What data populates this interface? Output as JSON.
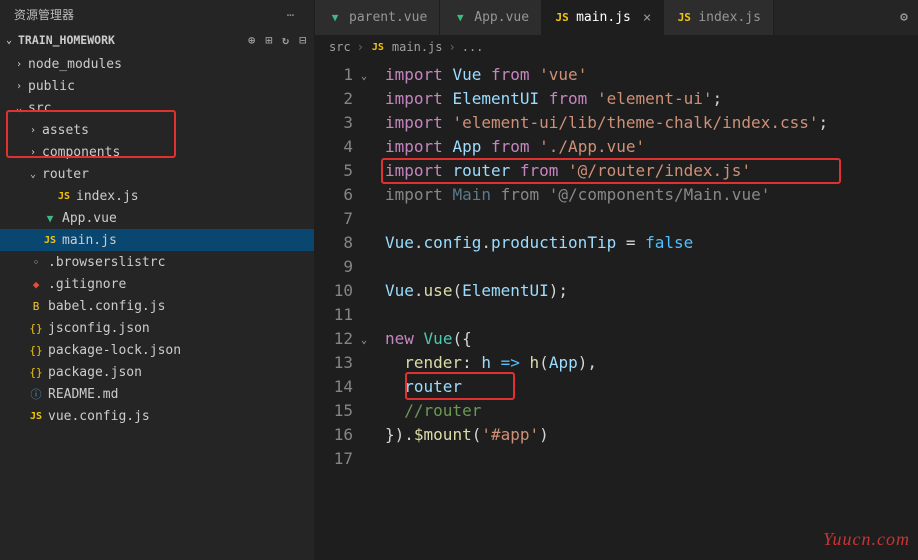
{
  "sidebar": {
    "title": "资源管理器",
    "project": "TRAIN_HOMEWORK",
    "tree": [
      {
        "depth": 0,
        "chev": "›",
        "icon": "",
        "iconCls": "",
        "label": "node_modules"
      },
      {
        "depth": 0,
        "chev": "›",
        "icon": "",
        "iconCls": "",
        "label": "public"
      },
      {
        "depth": 0,
        "chev": "⌄",
        "icon": "",
        "iconCls": "",
        "label": "src"
      },
      {
        "depth": 1,
        "chev": "›",
        "icon": "",
        "iconCls": "",
        "label": "assets"
      },
      {
        "depth": 1,
        "chev": "›",
        "icon": "",
        "iconCls": "",
        "label": "components"
      },
      {
        "depth": 1,
        "chev": "⌄",
        "icon": "",
        "iconCls": "",
        "label": "router",
        "box": "start"
      },
      {
        "depth": 2,
        "chev": "",
        "icon": "JS",
        "iconCls": "ic-js",
        "label": "index.js",
        "box": "end"
      },
      {
        "depth": 1,
        "chev": "",
        "icon": "▼",
        "iconCls": "ic-vue",
        "label": "App.vue"
      },
      {
        "depth": 1,
        "chev": "",
        "icon": "JS",
        "iconCls": "ic-js",
        "label": "main.js",
        "selected": true
      },
      {
        "depth": 0,
        "chev": "",
        "icon": "◦",
        "iconCls": "",
        "label": ".browserslistrc"
      },
      {
        "depth": 0,
        "chev": "",
        "icon": "◆",
        "iconCls": "ic-git",
        "label": ".gitignore"
      },
      {
        "depth": 0,
        "chev": "",
        "icon": "B",
        "iconCls": "ic-babel",
        "label": "babel.config.js"
      },
      {
        "depth": 0,
        "chev": "",
        "icon": "{}",
        "iconCls": "ic-json",
        "label": "jsconfig.json"
      },
      {
        "depth": 0,
        "chev": "",
        "icon": "{}",
        "iconCls": "ic-json",
        "label": "package-lock.json"
      },
      {
        "depth": 0,
        "chev": "",
        "icon": "{}",
        "iconCls": "ic-json",
        "label": "package.json"
      },
      {
        "depth": 0,
        "chev": "",
        "icon": "ⓘ",
        "iconCls": "ic-md",
        "label": "README.md"
      },
      {
        "depth": 0,
        "chev": "",
        "icon": "JS",
        "iconCls": "ic-js",
        "label": "vue.config.js"
      }
    ]
  },
  "tabs": [
    {
      "icon": "▼",
      "iconCls": "ic-vue",
      "label": "parent.vue",
      "active": false
    },
    {
      "icon": "▼",
      "iconCls": "ic-vue",
      "label": "App.vue",
      "active": false
    },
    {
      "icon": "JS",
      "iconCls": "ic-js",
      "label": "main.js",
      "active": true,
      "close": "×"
    },
    {
      "icon": "JS",
      "iconCls": "ic-js",
      "label": "index.js",
      "active": false
    }
  ],
  "breadcrumb": {
    "part1": "src",
    "part2": "main.js",
    "part3": "..."
  },
  "code": {
    "lines": [
      {
        "n": 1,
        "fold": true,
        "html": "<span class='tok-kw'>import</span> <span class='tok-id'>Vue</span> <span class='tok-kw'>from</span> <span class='tok-str'>'vue'</span>"
      },
      {
        "n": 2,
        "html": "<span class='tok-kw'>import</span> <span class='tok-id'>ElementUI</span> <span class='tok-kw'>from</span> <span class='tok-str'>'element-ui'</span><span class='tok-punc'>;</span>"
      },
      {
        "n": 3,
        "html": "<span class='tok-kw'>import</span> <span class='tok-str'>'element-ui/lib/theme-chalk/index.css'</span><span class='tok-punc'>;</span>"
      },
      {
        "n": 4,
        "html": "<span class='tok-kw'>import</span> <span class='tok-id'>App</span> <span class='tok-kw'>from</span> <span class='tok-str'>'./App.vue'</span>"
      },
      {
        "n": 5,
        "html": "<span class='tok-kw'>import</span> <span class='tok-id'>router</span> <span class='tok-kw'>from</span> <span class='tok-str'>'@/router/index.js'</span>"
      },
      {
        "n": 6,
        "html": "<span class='tok-dim'>import</span> <span class='tok-id-dim'>Main</span> <span class='tok-dim'>from</span> <span class='tok-dim'>'@/components/Main.vue'</span>"
      },
      {
        "n": 7,
        "html": ""
      },
      {
        "n": 8,
        "html": "<span class='tok-id'>Vue</span><span class='tok-punc'>.</span><span class='tok-id'>config</span><span class='tok-punc'>.</span><span class='tok-id'>productionTip</span> <span class='tok-op'>=</span> <span class='tok-var'>false</span>"
      },
      {
        "n": 9,
        "html": ""
      },
      {
        "n": 10,
        "html": "<span class='tok-id'>Vue</span><span class='tok-punc'>.</span><span class='tok-fn'>use</span><span class='tok-punc'>(</span><span class='tok-id'>ElementUI</span><span class='tok-punc'>);</span>"
      },
      {
        "n": 11,
        "html": ""
      },
      {
        "n": 12,
        "fold": true,
        "html": "<span class='tok-kw'>new</span> <span class='tok-type'>Vue</span><span class='tok-punc'>({</span>"
      },
      {
        "n": 13,
        "html": "  <span class='tok-fn'>render</span><span class='tok-punc'>:</span> <span class='tok-id'>h</span> <span class='tok-var'>=></span> <span class='tok-fn'>h</span><span class='tok-punc'>(</span><span class='tok-id'>App</span><span class='tok-punc'>),</span>"
      },
      {
        "n": 14,
        "html": "  <span class='tok-id'>router</span>"
      },
      {
        "n": 15,
        "html": "  <span class='tok-comment'>//router</span>"
      },
      {
        "n": 16,
        "html": "<span class='tok-punc'>}).</span><span class='tok-fn'>$mount</span><span class='tok-punc'>(</span><span class='tok-str'>'#app'</span><span class='tok-punc'>)</span>"
      },
      {
        "n": 17,
        "html": ""
      }
    ]
  },
  "watermark": "Yuucn.com"
}
